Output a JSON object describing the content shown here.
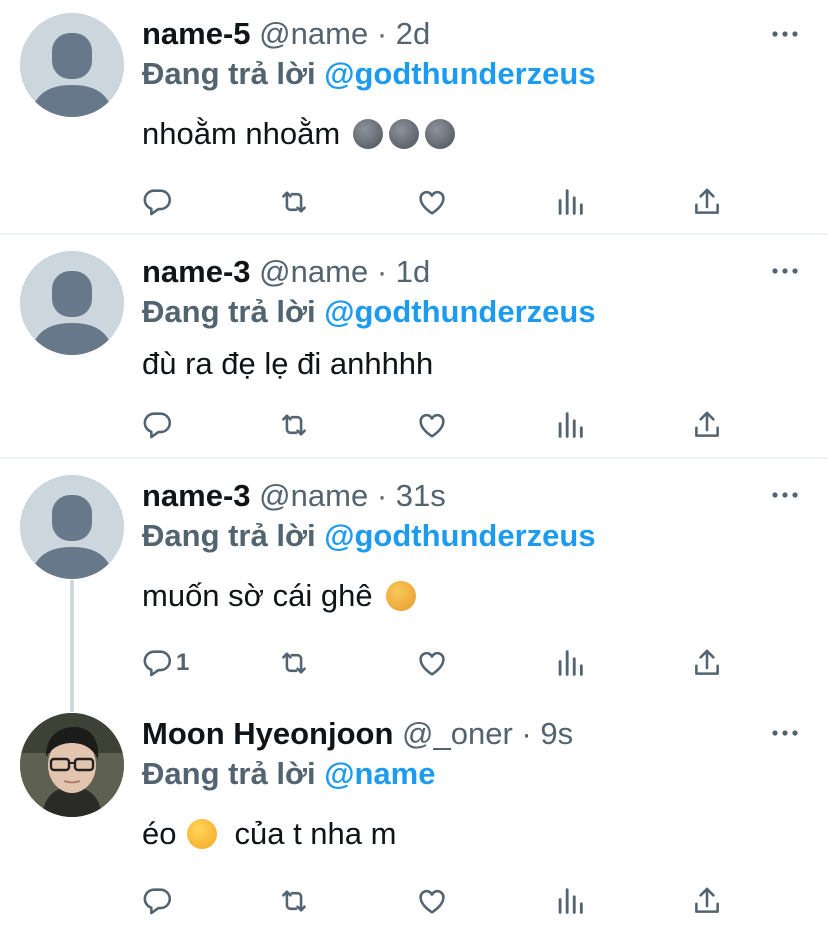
{
  "colors": {
    "link": "#1d9bf0",
    "secondary": "#536471",
    "text": "#0f1419",
    "divider": "#eff3f4"
  },
  "icons": {
    "more": "more-dots-icon",
    "reply": "reply-icon",
    "retweet": "retweet-icon",
    "like": "heart-icon",
    "views": "views-icon",
    "share": "share-icon"
  },
  "tweets": [
    {
      "name": "name-5",
      "handle": "@name",
      "dot": "·",
      "time": "2d",
      "replying_label": "Đang trả lời",
      "mention": "@godthunderzeus",
      "text": "nhoằm nhoằm",
      "emojis": [
        "new-moon-face",
        "new-moon-face",
        "new-moon-face"
      ],
      "reply_count": ""
    },
    {
      "name": "name-3",
      "handle": "@name",
      "dot": "·",
      "time": "1d",
      "replying_label": "Đang trả lời",
      "mention": "@godthunderzeus",
      "text": "đù ra đẹ lẹ đi anhhhh",
      "emojis": [],
      "reply_count": ""
    },
    {
      "name": "name-3",
      "handle": "@name",
      "dot": "·",
      "time": "31s",
      "replying_label": "Đang trả lời",
      "mention": "@godthunderzeus",
      "text": "muốn sờ cái ghê",
      "emojis": [
        "heart-eyes-cat"
      ],
      "reply_count": "1"
    },
    {
      "name": "Moon Hyeonjoon",
      "handle": "@_oner",
      "dot": "·",
      "time": "9s",
      "replying_label": "Đang trả lời",
      "mention": "@name",
      "text_before": "éo",
      "text_after": "của t nha m",
      "emojis": [
        "upside-down-face"
      ],
      "reply_count": ""
    }
  ]
}
